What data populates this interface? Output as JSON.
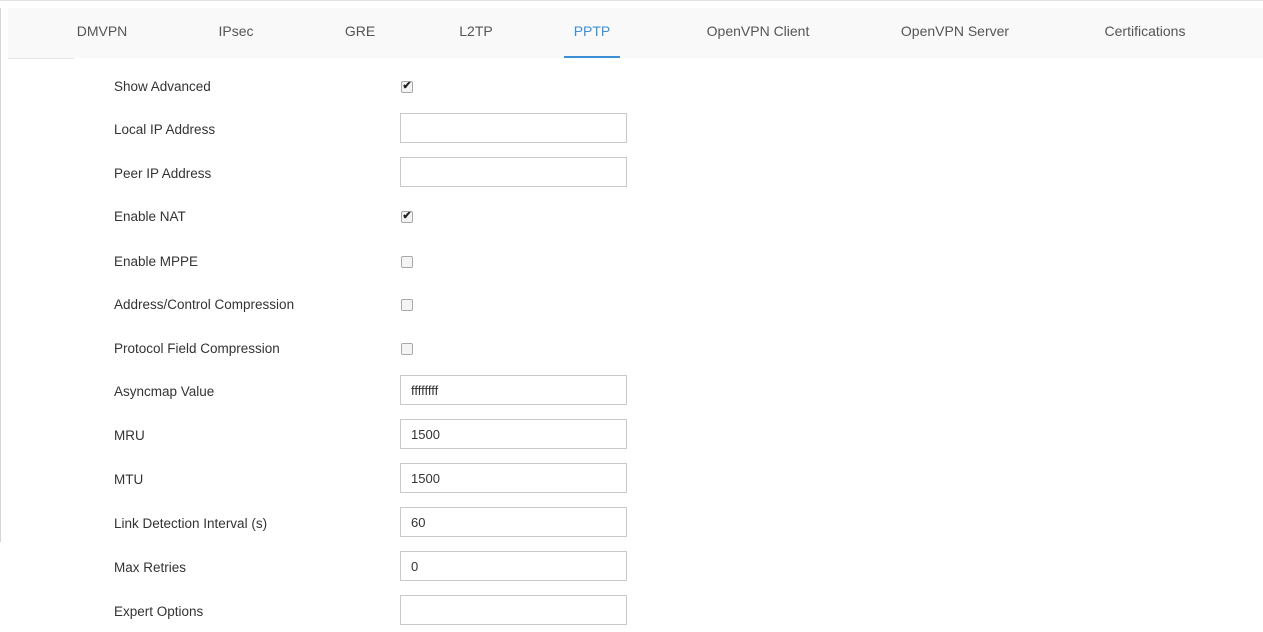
{
  "tabs": [
    {
      "label": "DMVPN",
      "active": false
    },
    {
      "label": "IPsec",
      "active": false
    },
    {
      "label": "GRE",
      "active": false
    },
    {
      "label": "L2TP",
      "active": false
    },
    {
      "label": "PPTP",
      "active": true
    },
    {
      "label": "OpenVPN Client",
      "active": false
    },
    {
      "label": "OpenVPN Server",
      "active": false
    },
    {
      "label": "Certifications",
      "active": false
    }
  ],
  "accent_color": "#3a8fd6",
  "form": {
    "show_advanced": {
      "label": "Show Advanced",
      "checked": true
    },
    "local_ip": {
      "label": "Local IP Address",
      "value": ""
    },
    "peer_ip": {
      "label": "Peer IP Address",
      "value": ""
    },
    "enable_nat": {
      "label": "Enable NAT",
      "checked": true
    },
    "enable_mppe": {
      "label": "Enable MPPE",
      "checked": false
    },
    "addr_ctrl_comp": {
      "label": "Address/Control Compression",
      "checked": false
    },
    "proto_field_comp": {
      "label": "Protocol Field Compression",
      "checked": false
    },
    "asyncmap": {
      "label": "Asyncmap Value",
      "value": "ffffffff"
    },
    "mru": {
      "label": "MRU",
      "value": "1500"
    },
    "mtu": {
      "label": "MTU",
      "value": "1500"
    },
    "link_detect": {
      "label": "Link Detection Interval (s)",
      "value": "60"
    },
    "max_retries": {
      "label": "Max Retries",
      "value": "0"
    },
    "expert": {
      "label": "Expert Options",
      "value": ""
    }
  }
}
